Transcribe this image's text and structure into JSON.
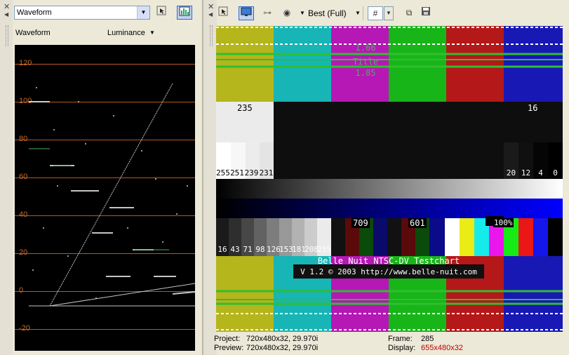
{
  "left_panel": {
    "selector_value": "Waveform",
    "subheader": "Waveform",
    "mode_label": "Luminance",
    "scale_labels": [
      "120",
      "100",
      "80",
      "60",
      "40",
      "20",
      "0",
      "-20"
    ]
  },
  "right_panel": {
    "quality_label": "Best (Full)",
    "status": {
      "project_label": "Project:",
      "project_value": "720x480x32, 29.970i",
      "preview_label": "Preview:",
      "preview_value": "720x480x32, 29.970i",
      "frame_label": "Frame:",
      "frame_value": "285",
      "display_label": "Display:",
      "display_value": "655x480x32",
      "display_color": "#c00000"
    }
  },
  "testchart": {
    "title_safe": [
      "Title",
      "1.85"
    ],
    "title_safe_top": "1.66",
    "level_high": "235",
    "level_low": "16",
    "steps_left": [
      "255",
      "251",
      "239",
      "231"
    ],
    "steps_right": [
      "20",
      "12",
      "4",
      "0"
    ],
    "gray_steps": [
      "16",
      "43",
      "71",
      "98",
      "126",
      "153",
      "181",
      "208",
      "235"
    ],
    "mark_709": "709",
    "mark_601": "601",
    "mark_100": "100%",
    "name": "Belle Nuit NTSC-DV Testchart",
    "version": "V 1.2 © 2003 http://www.belle-nuit.com"
  },
  "colors": {
    "bars": [
      "#b5b51c",
      "#17b5b5",
      "#b518b5",
      "#18b518",
      "#b51818",
      "#1818b5"
    ]
  }
}
